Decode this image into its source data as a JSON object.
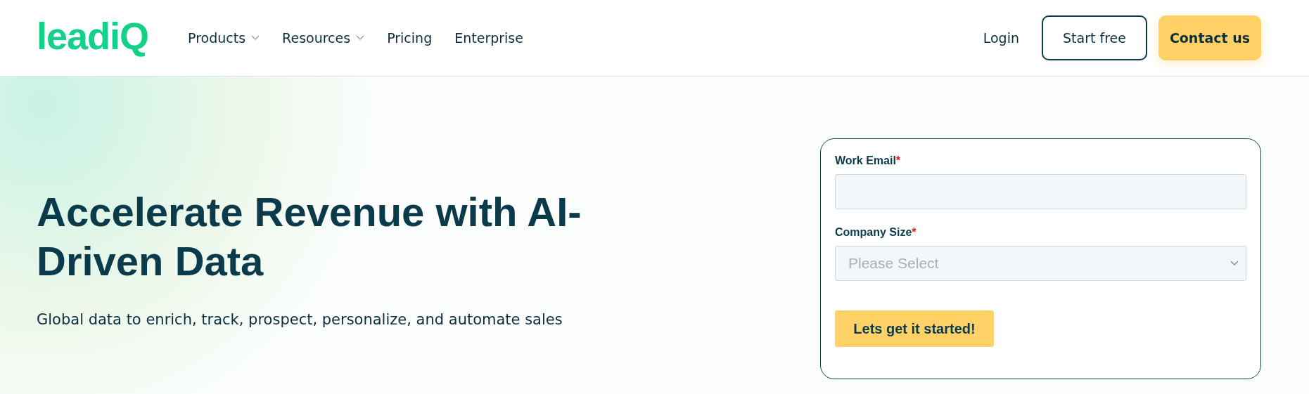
{
  "header": {
    "logo": "leadiQ",
    "nav": [
      {
        "label": "Products",
        "dropdown": true
      },
      {
        "label": "Resources",
        "dropdown": true
      },
      {
        "label": "Pricing",
        "dropdown": false
      },
      {
        "label": "Enterprise",
        "dropdown": false
      }
    ],
    "login": "Login",
    "start_free": "Start free",
    "contact": "Contact us"
  },
  "hero": {
    "title": "Accelerate Revenue with AI-Driven Data",
    "subtitle": "Global data to enrich, track, prospect, personalize, and automate sales"
  },
  "form": {
    "fields": [
      {
        "kind": "text",
        "label": "Work Email",
        "required_mark": "*"
      },
      {
        "kind": "select",
        "label": "Company Size",
        "required_mark": "*",
        "placeholder": "Please Select"
      }
    ],
    "submit": "Lets get it started!"
  }
}
